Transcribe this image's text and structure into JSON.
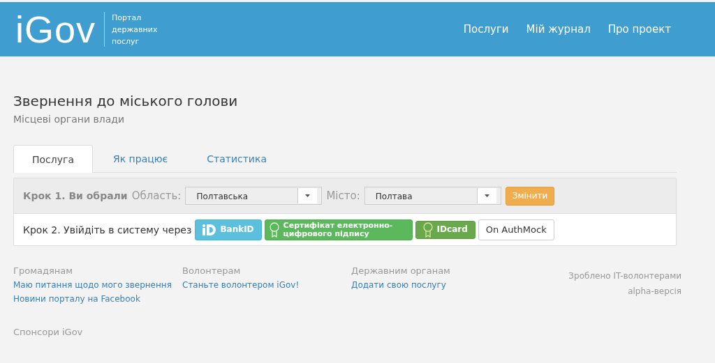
{
  "header": {
    "logo": "iGov",
    "tagline": "Портал державних послуг",
    "nav": [
      "Послуги",
      "Мій журнал",
      "Про проект"
    ]
  },
  "service": {
    "title": "Звернення до міського голови",
    "subtitle": "Місцеві органи влади"
  },
  "tabs": [
    {
      "label": "Послуга",
      "selected": true
    },
    {
      "label": "Як працює",
      "selected": false
    },
    {
      "label": "Статистика",
      "selected": false
    }
  ],
  "step1": {
    "label": "Крок 1. Ви обрали",
    "region_label": "Область:",
    "region_value": "Полтавська",
    "city_label": "Місто:",
    "city_value": "Полтава",
    "change_button": "Змінити"
  },
  "step2": {
    "label": "Крок 2. Увійдіть в систему через",
    "auth_buttons": [
      {
        "kind": "bankid",
        "label": "BankID"
      },
      {
        "kind": "certificate",
        "label": "Сертифікат електронно-цифрового підпису"
      },
      {
        "kind": "idcard",
        "label": "IDcard"
      },
      {
        "kind": "plain",
        "label": "On AuthMock"
      }
    ]
  },
  "footer": {
    "columns": [
      {
        "heading": "Громадянам",
        "links": [
          "Маю питання щодо мого звернення",
          "Новини порталу на Facebook"
        ]
      },
      {
        "heading": "Волонтерам",
        "links": [
          "Станьте волонтером iGov!"
        ]
      },
      {
        "heading": "Державним органам",
        "links": [
          "Додати свою послугу"
        ]
      }
    ],
    "credits": [
      "Зроблено IT-волонтерами",
      "alpha-версія"
    ],
    "sponsors": "Спонсори iGov"
  }
}
